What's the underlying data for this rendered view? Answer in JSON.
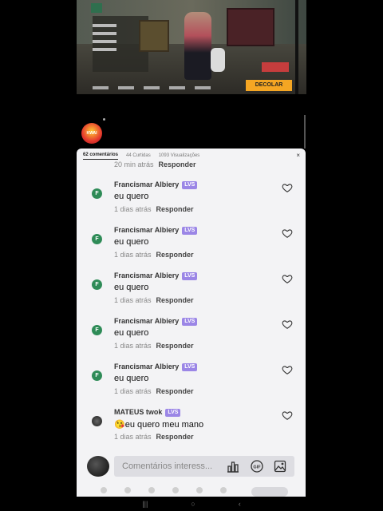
{
  "game": {
    "declab_label": "DECOLAR"
  },
  "live_badge": {
    "text": "KWAI"
  },
  "tabs": [
    {
      "label": "62 comentários",
      "active": true
    },
    {
      "label": "44 Curtidas",
      "active": false
    },
    {
      "label": "1093 Visualizações",
      "active": false
    }
  ],
  "partial_comment": {
    "time": "20 min atrás",
    "reply": "Responder"
  },
  "comments": [
    {
      "avatar": "F",
      "name": "Francismar Albiery",
      "tag": "LVS",
      "text": "eu quero",
      "time": "1 dias atrás",
      "reply": "Responder"
    },
    {
      "avatar": "F",
      "name": "Francismar Albiery",
      "tag": "LVS",
      "text": "eu quero",
      "time": "1 dias atrás",
      "reply": "Responder"
    },
    {
      "avatar": "F",
      "name": "Francismar Albiery",
      "tag": "LVS",
      "text": "eu quero",
      "time": "1 dias atrás",
      "reply": "Responder"
    },
    {
      "avatar": "F",
      "name": "Francismar Albiery",
      "tag": "LVS",
      "text": "eu quero",
      "time": "1 dias atrás",
      "reply": "Responder"
    },
    {
      "avatar": "F",
      "name": "Francismar Albiery",
      "tag": "LVS",
      "text": "eu quero",
      "time": "1 dias atrás",
      "reply": "Responder"
    },
    {
      "avatar": "",
      "name": "MATEUS twok",
      "tag": "LVS",
      "text": "😘eu quero meu mano",
      "time": "1 dias atrás",
      "reply": "Responder"
    }
  ],
  "input": {
    "placeholder": "Comentários interess..."
  },
  "close_glyph": "×",
  "colors": {
    "tag_bg": "#9b86e6",
    "avatar_bg": "#2e8b57",
    "declab_bg": "#f5a623"
  },
  "icons": {
    "like": "heart-icon",
    "chart": "bar-chart-icon",
    "gif": "gif-icon",
    "image": "image-icon",
    "close": "close-icon"
  },
  "navbar": {
    "recent": "|||",
    "home": "○",
    "back": "‹"
  }
}
